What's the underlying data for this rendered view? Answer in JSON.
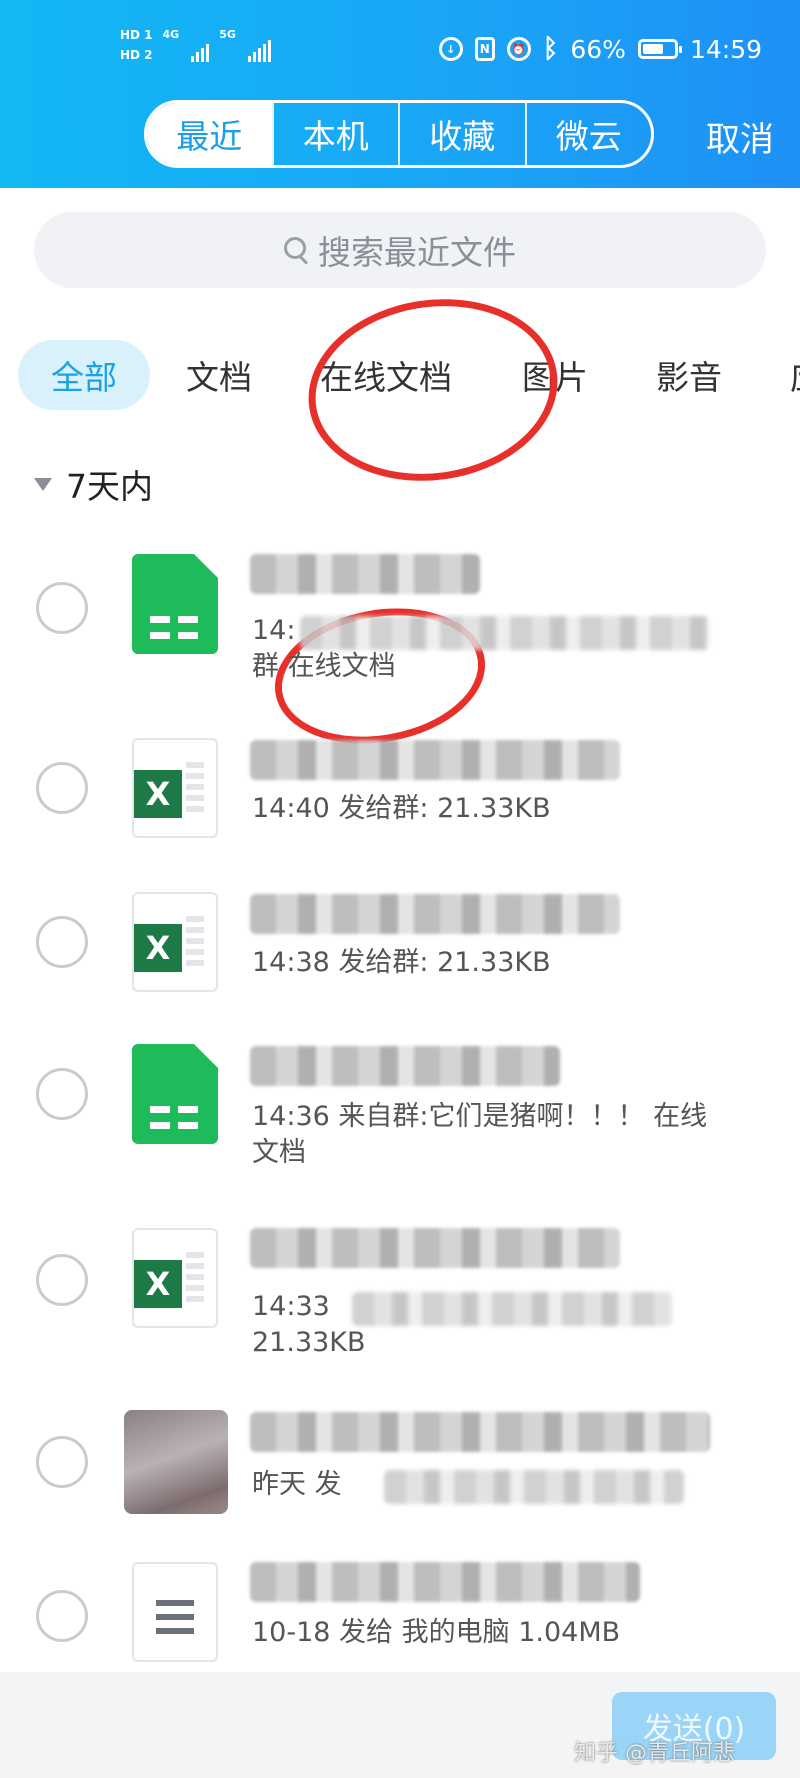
{
  "status_bar": {
    "hd1": "HD 1",
    "hd2": "HD 2",
    "net1": "4G",
    "net2": "5G",
    "battery_percent": "66%",
    "battery_level": 0.66,
    "time": "14:59",
    "icons": [
      "hd-icon",
      "signal-icon",
      "nfc-icon",
      "alarm-icon",
      "bluetooth-icon",
      "battery-icon"
    ]
  },
  "header": {
    "tabs": [
      {
        "label": "最近",
        "active": true
      },
      {
        "label": "本机",
        "active": false
      },
      {
        "label": "收藏",
        "active": false
      },
      {
        "label": "微云",
        "active": false
      }
    ],
    "cancel_label": "取消",
    "accent": "#19A6F6"
  },
  "search": {
    "placeholder": "搜索最近文件"
  },
  "categories": [
    {
      "label": "全部",
      "active": true
    },
    {
      "label": "文档",
      "active": false
    },
    {
      "label": "在线文档",
      "active": false
    },
    {
      "label": "图片",
      "active": false
    },
    {
      "label": "影音",
      "active": false
    },
    {
      "label": "应",
      "active": false
    }
  ],
  "group": {
    "label": "7天内"
  },
  "files": [
    {
      "icon": "online-sheet-icon",
      "meta_start": "14:",
      "meta_line2": "群 在线文档"
    },
    {
      "icon": "excel-icon",
      "meta": "14:40 发给群: 21.33KB"
    },
    {
      "icon": "excel-icon",
      "meta": "14:38 发给群: 21.33KB"
    },
    {
      "icon": "online-sheet-icon",
      "meta": "14:36 来自群:它们是猪啊！！！ 在线",
      "meta_line2": "文档"
    },
    {
      "icon": "excel-icon",
      "meta": "14:33",
      "meta_line2": "21.33KB"
    },
    {
      "icon": "image-thumbnail",
      "meta": "昨天 发"
    },
    {
      "icon": "document-icon",
      "meta": "10-18 发给 我的电脑 1.04MB"
    }
  ],
  "footer": {
    "send_label": "发送(0)",
    "watermark": "知乎 @青丘阿悲"
  },
  "annotation_color": "#E8302A"
}
